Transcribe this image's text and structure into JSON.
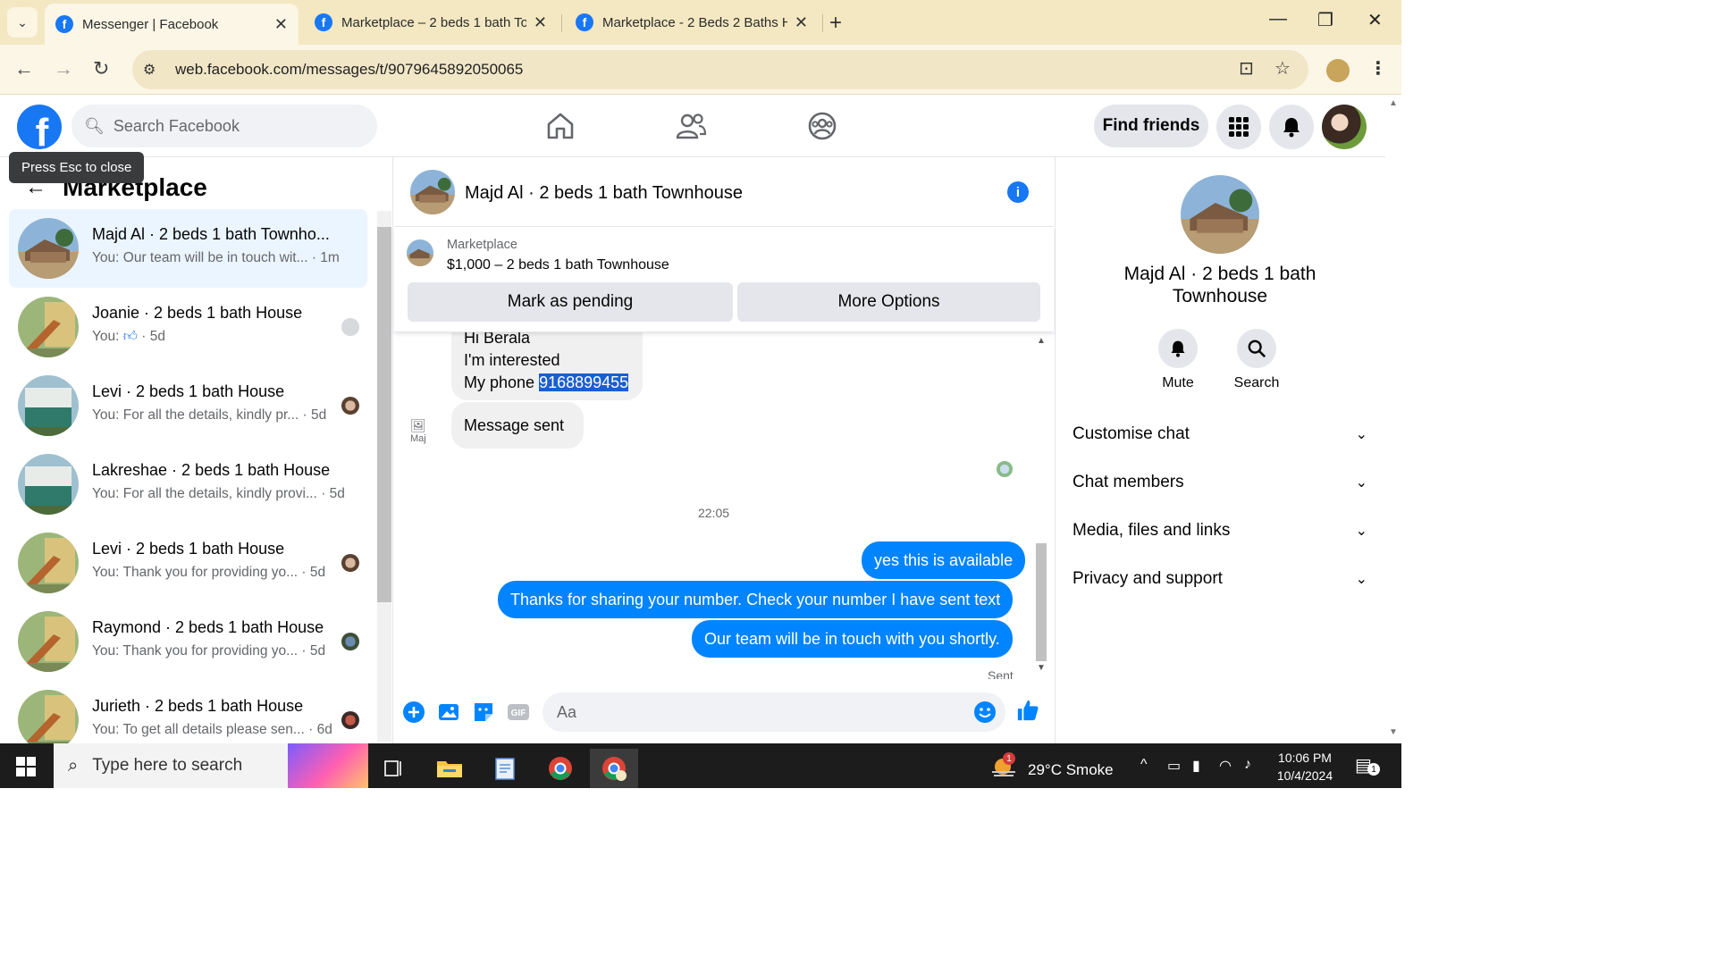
{
  "browser": {
    "tabs": [
      {
        "title": "Messenger | Facebook",
        "active": true
      },
      {
        "title": "Marketplace – 2 beds 1 bath To",
        "active": false
      },
      {
        "title": "Marketplace - 2 Beds 2 Baths H",
        "active": false
      }
    ],
    "url": "web.facebook.com/messages/t/9079645892050065"
  },
  "fb_header": {
    "search_placeholder": "Search Facebook",
    "find_friends": "Find friends"
  },
  "tooltip": "Press Esc to close",
  "left_panel": {
    "title": "Marketplace",
    "conversations": [
      {
        "name": "Majd Al · 2 beds 1 bath Townho...",
        "preview": "You: Our team will be in touch wit...",
        "time": "· 1m",
        "active": true
      },
      {
        "name": "Joanie · 2 beds 1 bath House",
        "preview": "You:",
        "time": "· 5d",
        "active": false
      },
      {
        "name": "Levi · 2 beds 1 bath House",
        "preview": "You: For all the details, kindly pr...",
        "time": "· 5d",
        "active": false
      },
      {
        "name": "Lakreshae · 2 beds 1 bath House",
        "preview": "You: For all the details, kindly provi...",
        "time": "· 5d",
        "active": false
      },
      {
        "name": "Levi · 2 beds 1 bath House",
        "preview": "You: Thank you for providing yo...",
        "time": "· 5d",
        "active": false
      },
      {
        "name": "Raymond · 2 beds 1 bath House",
        "preview": "You: Thank you for providing yo...",
        "time": "· 5d",
        "active": false
      },
      {
        "name": "Jurieth · 2 beds 1 bath House",
        "preview": "You: To get all details please sen...",
        "time": "· 6d",
        "active": false
      }
    ]
  },
  "chat": {
    "title": "Majd Al · 2 beds 1 bath Townhouse",
    "marketplace_label": "Marketplace",
    "listing": "$1,000 – 2 beds 1 bath Townhouse",
    "mark_pending": "Mark as pending",
    "more_options": "More Options",
    "incoming": {
      "line1": "Hi Berala",
      "line2": "I'm interested",
      "line3_prefix": "My phone ",
      "phone": "9168899455"
    },
    "message_sent": "Message sent",
    "avatar_alt": "Maj",
    "timestamp": "22:05",
    "outgoing": [
      "yes this is available",
      "Thanks for sharing your number.  Check your number I have sent text",
      "Our team will be in touch with you shortly."
    ],
    "sent_status": "Sent",
    "composer_placeholder": "Aa"
  },
  "right_panel": {
    "name": "Majd Al · 2 beds 1 bath Townhouse",
    "mute": "Mute",
    "search": "Search",
    "sections": [
      "Customise chat",
      "Chat members",
      "Media, files and links",
      "Privacy and support"
    ]
  },
  "taskbar": {
    "search_placeholder": "Type here to search",
    "weather": "29°C  Smoke",
    "weather_badge": "1",
    "time": "10:06 PM",
    "date": "10/4/2024",
    "notif_count": "1"
  },
  "colors": {
    "fb_blue": "#1877f2",
    "messenger_blue": "#0084ff",
    "active_conv_bg": "#ebf5ff",
    "browser_tabbar": "#f3e8c2"
  }
}
